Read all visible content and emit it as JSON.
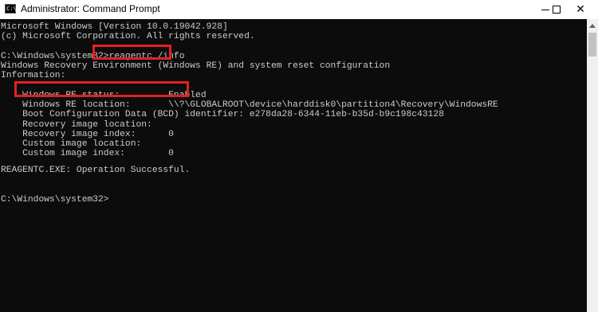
{
  "window": {
    "title": "Administrator: Command Prompt",
    "icon_label": "C:\\",
    "close_glyph": "✕"
  },
  "console": {
    "lines": [
      "Microsoft Windows [Version 10.0.19042.928]",
      "(c) Microsoft Corporation. All rights reserved.",
      "",
      "C:\\Windows\\system32>reagentc /info",
      "Windows Recovery Environment (Windows RE) and system reset configuration",
      "Information:",
      "",
      "    Windows RE status:         Enabled",
      "    Windows RE location:       \\\\?\\GLOBALROOT\\device\\harddisk0\\partition4\\Recovery\\WindowsRE",
      "    Boot Configuration Data (BCD) identifier: e278da28-6344-11eb-b35d-b9c198c43128",
      "    Recovery image location:",
      "    Recovery image index:      0",
      "    Custom image location:",
      "    Custom image index:        0",
      "",
      "REAGENTC.EXE: Operation Successful.",
      "",
      "",
      "C:\\Windows\\system32>"
    ]
  },
  "colors": {
    "console_bg": "#0c0c0c",
    "console_fg": "#cccccc",
    "highlight": "#e32020",
    "titlebar_bg": "#ffffff"
  },
  "icons": {
    "minimize": "minimize-icon",
    "maximize": "maximize-icon",
    "close": "close-icon",
    "scroll_up": "chevron-up-icon"
  }
}
